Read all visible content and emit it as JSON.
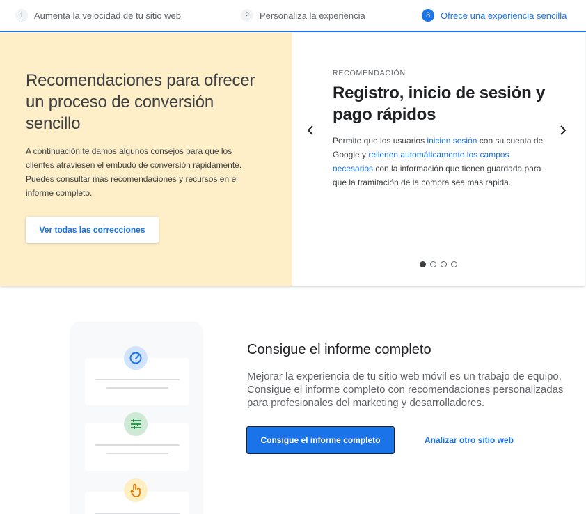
{
  "steps": [
    {
      "number": "1",
      "label": "Aumenta la velocidad de tu sitio web"
    },
    {
      "number": "2",
      "label": "Personaliza la experiencia"
    },
    {
      "number": "3",
      "label": "Ofrece una experiencia sencilla"
    }
  ],
  "active_step": 3,
  "hero": {
    "title": "Recomendaciones para ofrecer un proceso de conversión sencillo",
    "text": "A continuación te damos algunos consejos para que los clientes atraviesen el embudo de conversión rápidamente. Puedes consultar más recomendaciones y recursos en el informe completo.",
    "button_label": "Ver todas las correcciones"
  },
  "recommendation": {
    "kicker": "RECOMENDACIÓN",
    "title": "Registro, inicio de sesión y pago rápidos",
    "text_parts": [
      "Permite que los usuarios ",
      "iniciен sesión",
      " con su cuenta de Google y ",
      "rellenen automáticamente los campos necesarios",
      " con la información que tienen guardada para que la tramitación de la compra sea más rápida."
    ],
    "prev_icon": "chevron-left-icon",
    "next_icon": "chevron-right-icon",
    "dots_total": 4,
    "dots_active": 1
  },
  "report": {
    "title": "Consigue el informe completo",
    "text": "Mejorar la experiencia de tu sitio web móvil es un trabajo de equipo. Consigue el informe completo con recomendaciones personalizadas para profesionales del marketing y desarrolladores.",
    "primary_button": "Consigue el informe completo",
    "secondary_link": "Analizar otro sitio web"
  },
  "illustration_icons": [
    "speedometer-icon",
    "sliders-icon",
    "tap-hand-icon"
  ],
  "colors": {
    "accent": "#1a73e8",
    "hero_background": "#feefc9",
    "speed_icon_bg": "#d2e3fc",
    "sliders_icon_bg": "#ceead6",
    "hand_icon_bg": "#feefc3"
  }
}
